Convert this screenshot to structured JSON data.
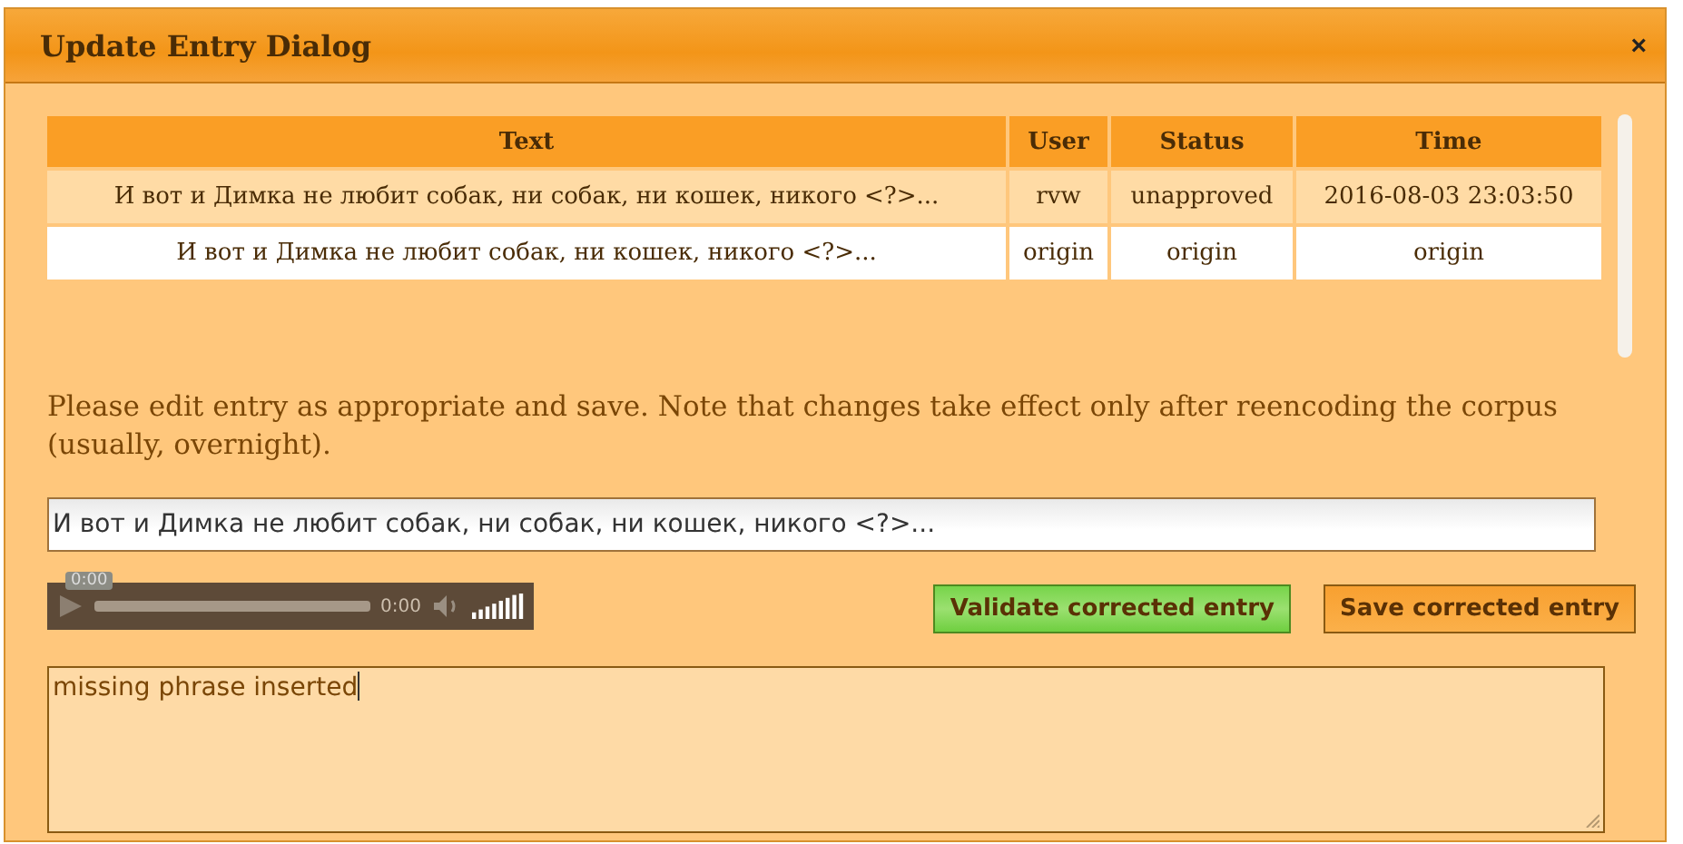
{
  "window": {
    "title": "Update Entry Dialog",
    "close": "×"
  },
  "table": {
    "columns": [
      "Text",
      "User",
      "Status",
      "Time"
    ],
    "rows": [
      {
        "cells": [
          "И вот и Димка не любит собак, ни собак, ни кошек, никого <?>...",
          "rvw",
          "unapproved",
          "2016-08-03 23:03:50"
        ],
        "selected": true
      },
      {
        "cells": [
          "И вот и Димка не любит собак, ни кошек, никого <?>...",
          "origin",
          "origin",
          "origin"
        ],
        "selected": false
      }
    ]
  },
  "instructions": "Please edit entry as appropriate and save. Note that changes take effect only after reencoding the corpus (usually, overnight).",
  "entry_field": {
    "value": "И вот и Димка не любит собак, ни собак, ни кошек, никого <?>..."
  },
  "audio_player": {
    "tooltip": "0:00",
    "time": "0:00"
  },
  "buttons": [
    {
      "label": "Validate corrected entry",
      "kind": "validate"
    },
    {
      "label": "Save corrected entry",
      "kind": "save"
    }
  ],
  "comment_field": {
    "value": "missing phrase inserted"
  }
}
